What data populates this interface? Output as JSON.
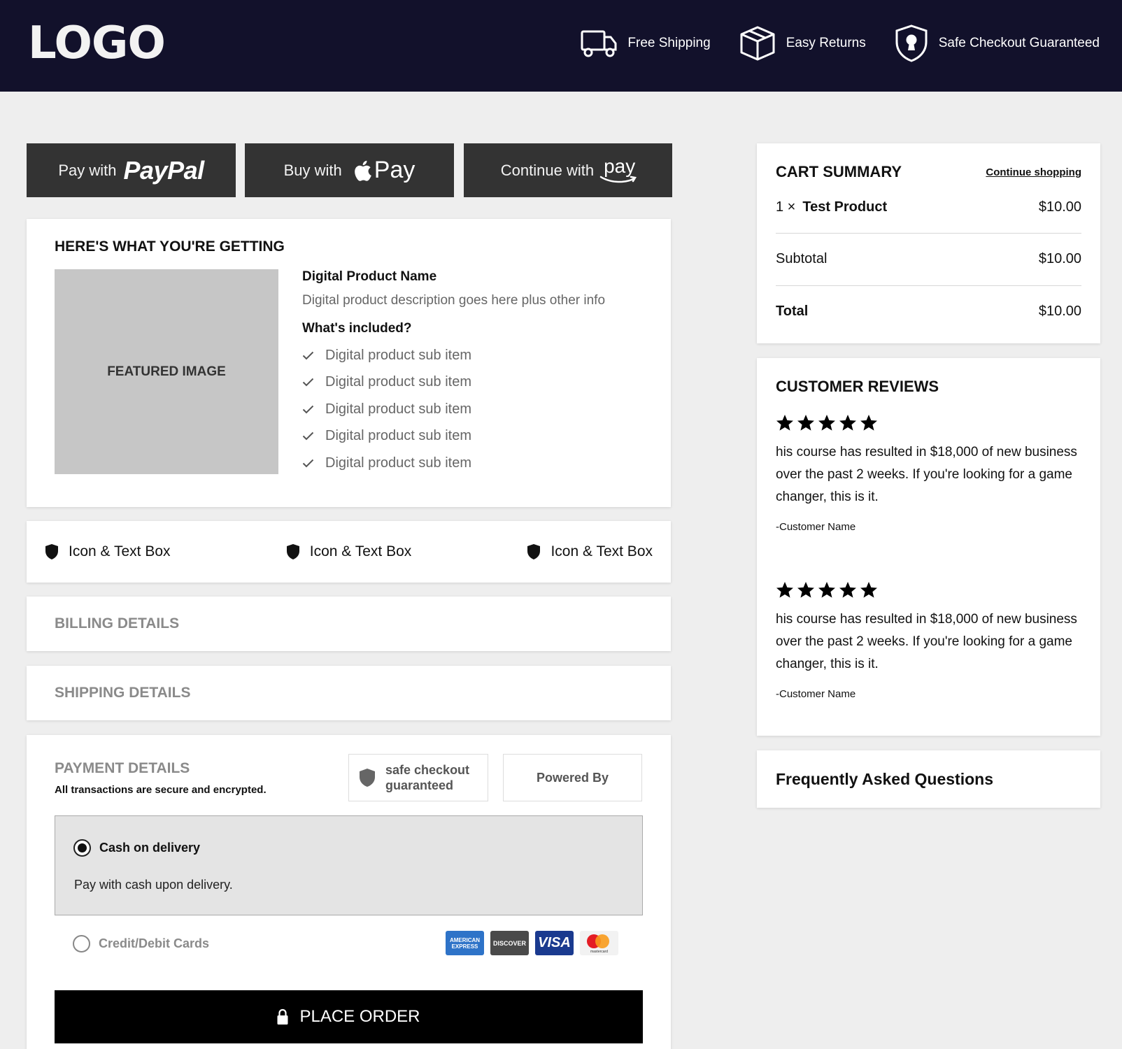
{
  "header": {
    "logo": "LOGO",
    "badges": [
      {
        "label": "Free Shipping",
        "icon": "truck-icon"
      },
      {
        "label": "Easy Returns",
        "icon": "box-icon"
      },
      {
        "label": "Safe Checkout Guaranteed",
        "icon": "shield-lock-icon"
      }
    ]
  },
  "express_pay": {
    "paypal": {
      "lead": "Pay with",
      "brand": "PayPal"
    },
    "applepay": {
      "lead": "Buy with",
      "brand": "Pay"
    },
    "amazonpay": {
      "lead": "Continue with",
      "brand": "pay"
    }
  },
  "product_card": {
    "title": "HERE'S WHAT YOU'RE GETTING",
    "image_label": "FEATURED IMAGE",
    "name": "Digital Product Name",
    "description": "Digital product description goes here plus other info",
    "included_heading": "What's included?",
    "items": [
      "Digital product sub item",
      "Digital product sub item",
      "Digital product sub item",
      "Digital product sub item",
      "Digital product sub item"
    ]
  },
  "icon_boxes": [
    "Icon & Text Box",
    "Icon & Text Box",
    "Icon & Text Box"
  ],
  "billing": {
    "title": "BILLING DETAILS"
  },
  "shipping": {
    "title": "SHIPPING DETAILS"
  },
  "payment": {
    "title": "PAYMENT DETAILS",
    "subtitle": "All transactions are secure and encrypted.",
    "safe_checkout_line1": "safe checkout",
    "safe_checkout_line2": "guaranteed",
    "powered_by": "Powered By",
    "methods": {
      "cod": {
        "label": "Cash on delivery",
        "description": "Pay with cash upon delivery.",
        "selected": true
      },
      "card": {
        "label": "Credit/Debit Cards",
        "selected": false
      }
    },
    "card_brands": {
      "amex": "AMERICAN EXPRESS",
      "discover": "DISCOVER",
      "visa": "VISA",
      "mastercard": "mastercard"
    },
    "place_order": "PLACE ORDER"
  },
  "cart_summary": {
    "title": "CART SUMMARY",
    "continue_link": "Continue shopping",
    "item_qty": "1 ×",
    "item_name": "Test Product",
    "item_price": "$10.00",
    "subtotal_label": "Subtotal",
    "subtotal_value": "$10.00",
    "total_label": "Total",
    "total_value": "$10.00"
  },
  "reviews": {
    "title": "CUSTOMER REVIEWS",
    "items": [
      {
        "stars": 5,
        "text": "his course has resulted in $18,000 of new business over the past 2 weeks. If you're looking for a game changer, this is it.",
        "author": "-Customer Name"
      },
      {
        "stars": 5,
        "text": "his course has resulted in $18,000 of new business over the past 2 weeks. If you're looking for a game changer, this is it.",
        "author": "-Customer Name"
      }
    ]
  },
  "faq": {
    "title": "Frequently Asked Questions"
  },
  "colors": {
    "header_bg": "#12112b",
    "pay_button_bg": "#333333",
    "page_bg": "#eeeeee"
  }
}
